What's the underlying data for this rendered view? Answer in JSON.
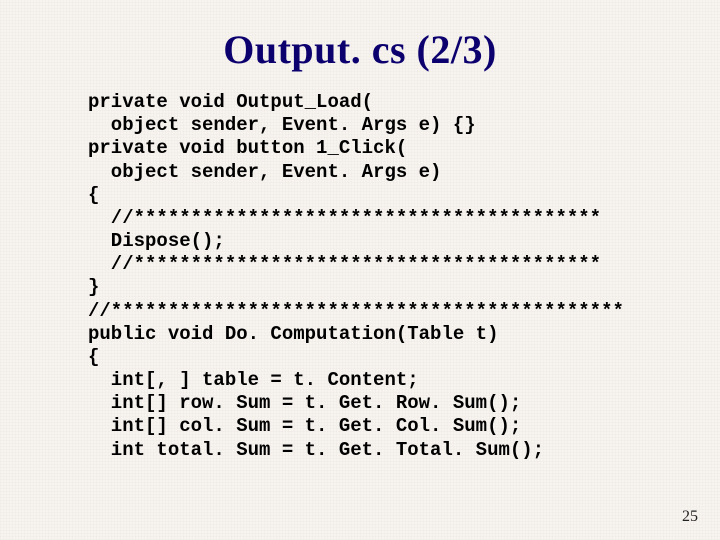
{
  "slide": {
    "title": "Output. cs (2/3)",
    "page_number": "25"
  },
  "code": {
    "l0": "private void Output_Load(",
    "l1": "  object sender, Event. Args e) {}",
    "l2": "private void button 1_Click(",
    "l3": "  object sender, Event. Args e)",
    "l4": "{",
    "l5": "  //*****************************************",
    "l6": "  Dispose();",
    "l7": "  //*****************************************",
    "l8": "}",
    "l9": "//*********************************************",
    "l10": "public void Do. Computation(Table t)",
    "l11": "{",
    "l12": "  int[, ] table = t. Content;",
    "l13": "  int[] row. Sum = t. Get. Row. Sum();",
    "l14": "  int[] col. Sum = t. Get. Col. Sum();",
    "l15": "  int total. Sum = t. Get. Total. Sum();"
  }
}
